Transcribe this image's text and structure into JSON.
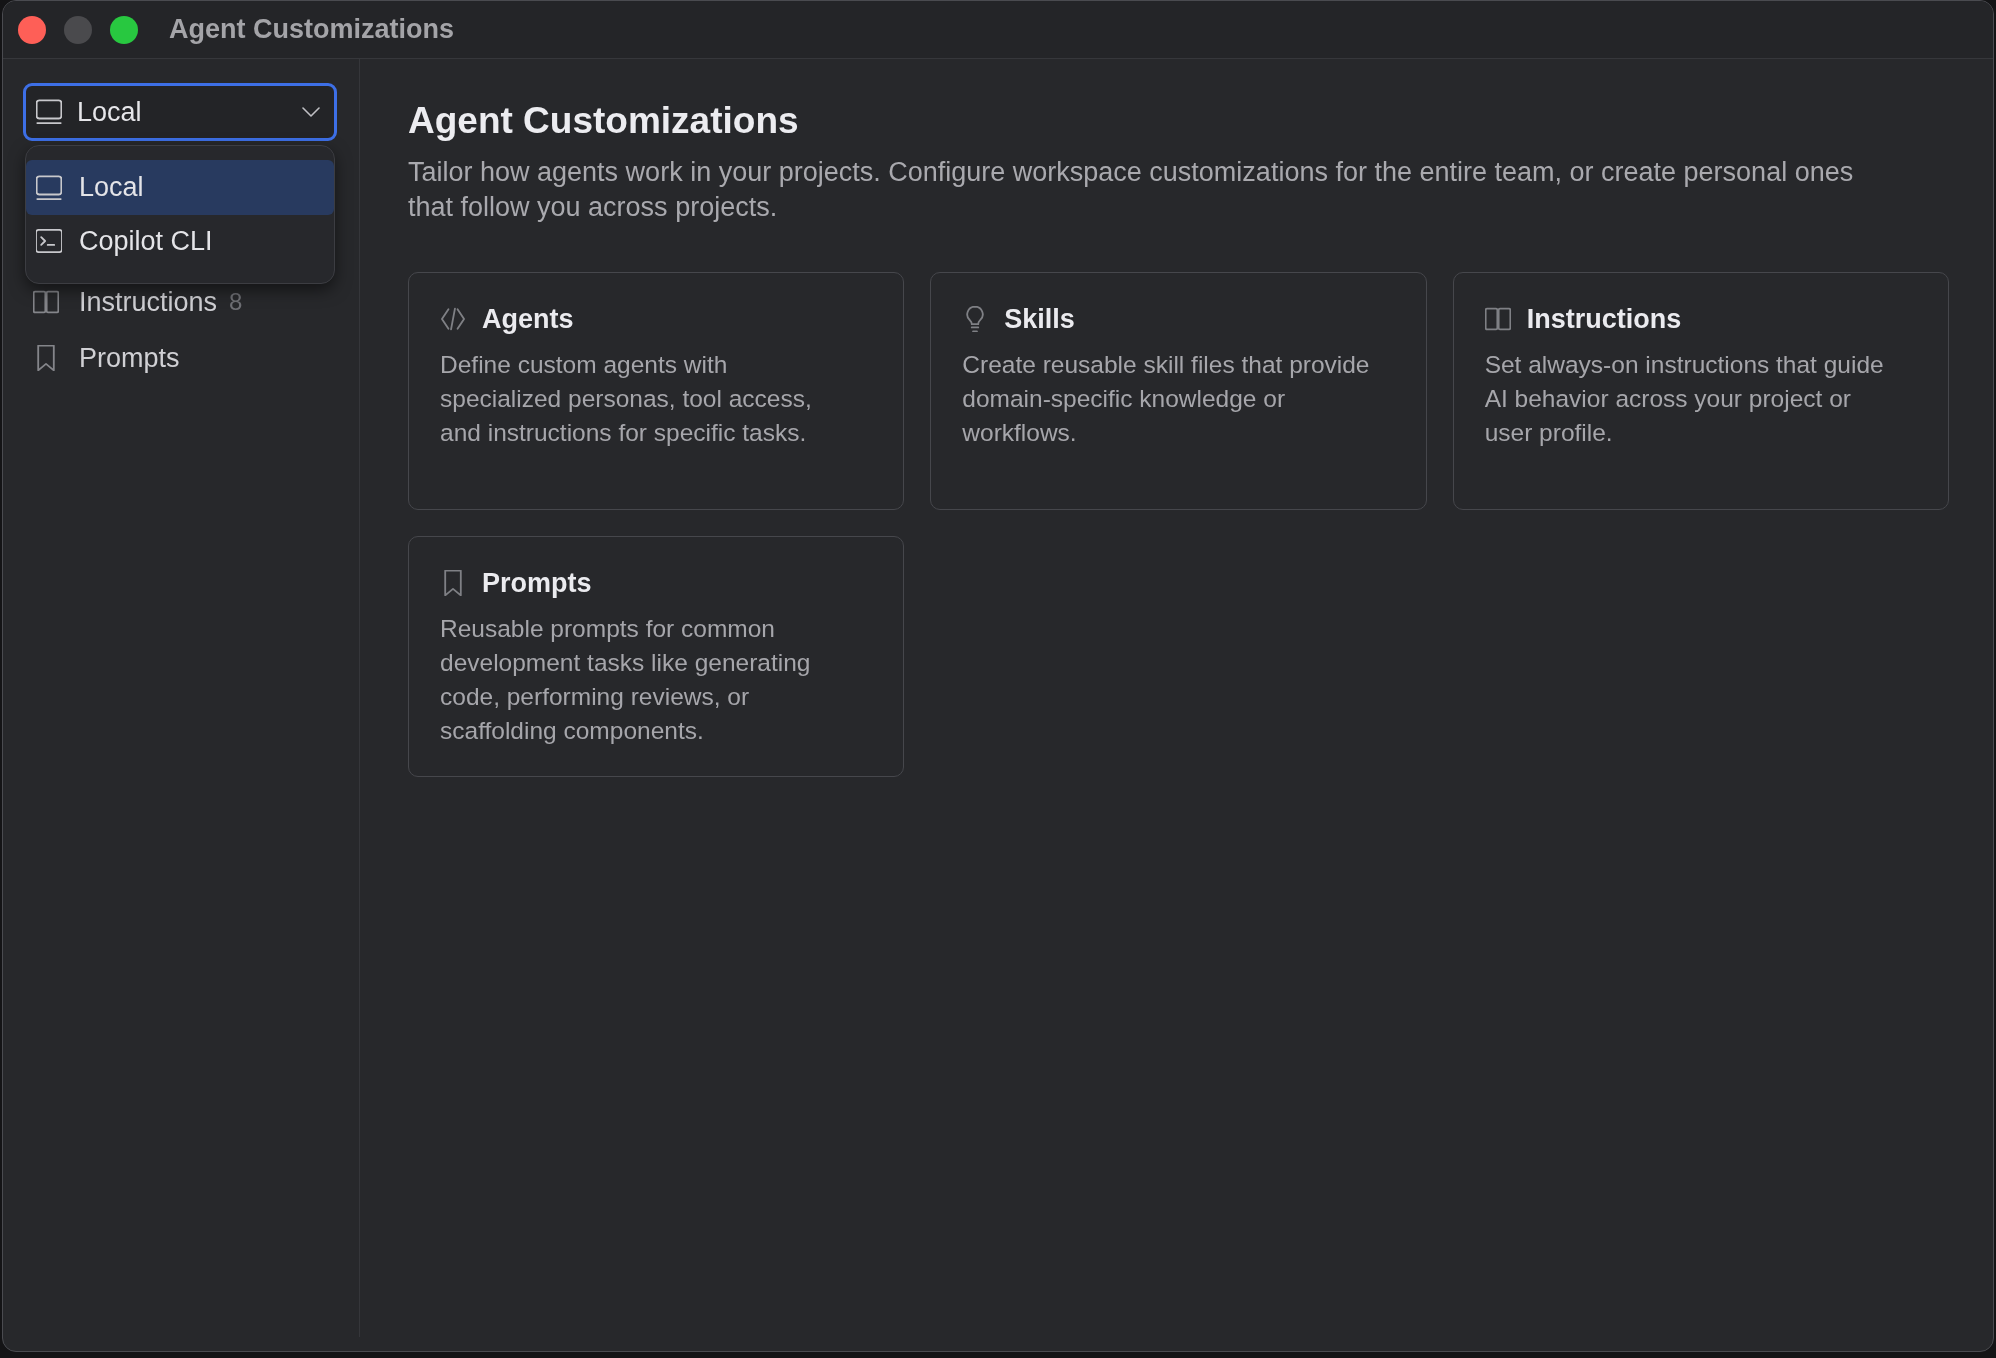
{
  "window": {
    "title": "Agent Customizations"
  },
  "sidebar": {
    "source_select": {
      "value": "Local",
      "kind": "local",
      "expanded": true,
      "options": [
        {
          "label": "Local",
          "kind": "local",
          "selected": true
        },
        {
          "label": "Copilot CLI",
          "kind": "cli",
          "selected": false
        }
      ]
    },
    "items": [
      {
        "label": "Instructions",
        "count": "8",
        "kind": "instructions"
      },
      {
        "label": "Prompts",
        "kind": "prompts"
      }
    ]
  },
  "main": {
    "heading": "Agent Customizations",
    "description": "Tailor how agents work in your projects. Configure workspace customizations for the entire team, or create personal ones that follow you across projects.",
    "cards": [
      {
        "kind": "agents",
        "title": "Agents",
        "description": "Define custom agents with specialized personas, tool access, and instructions for specific tasks."
      },
      {
        "kind": "skills",
        "title": "Skills",
        "description": "Create reusable skill files that provide domain-specific knowledge or workflows."
      },
      {
        "kind": "instructions",
        "title": "Instructions",
        "description": "Set always-on instructions that guide AI behavior across your project or user profile."
      },
      {
        "kind": "prompts",
        "title": "Prompts",
        "description": "Reusable prompts for common development tasks like generating code, performing reviews, or scaffolding components."
      }
    ]
  }
}
